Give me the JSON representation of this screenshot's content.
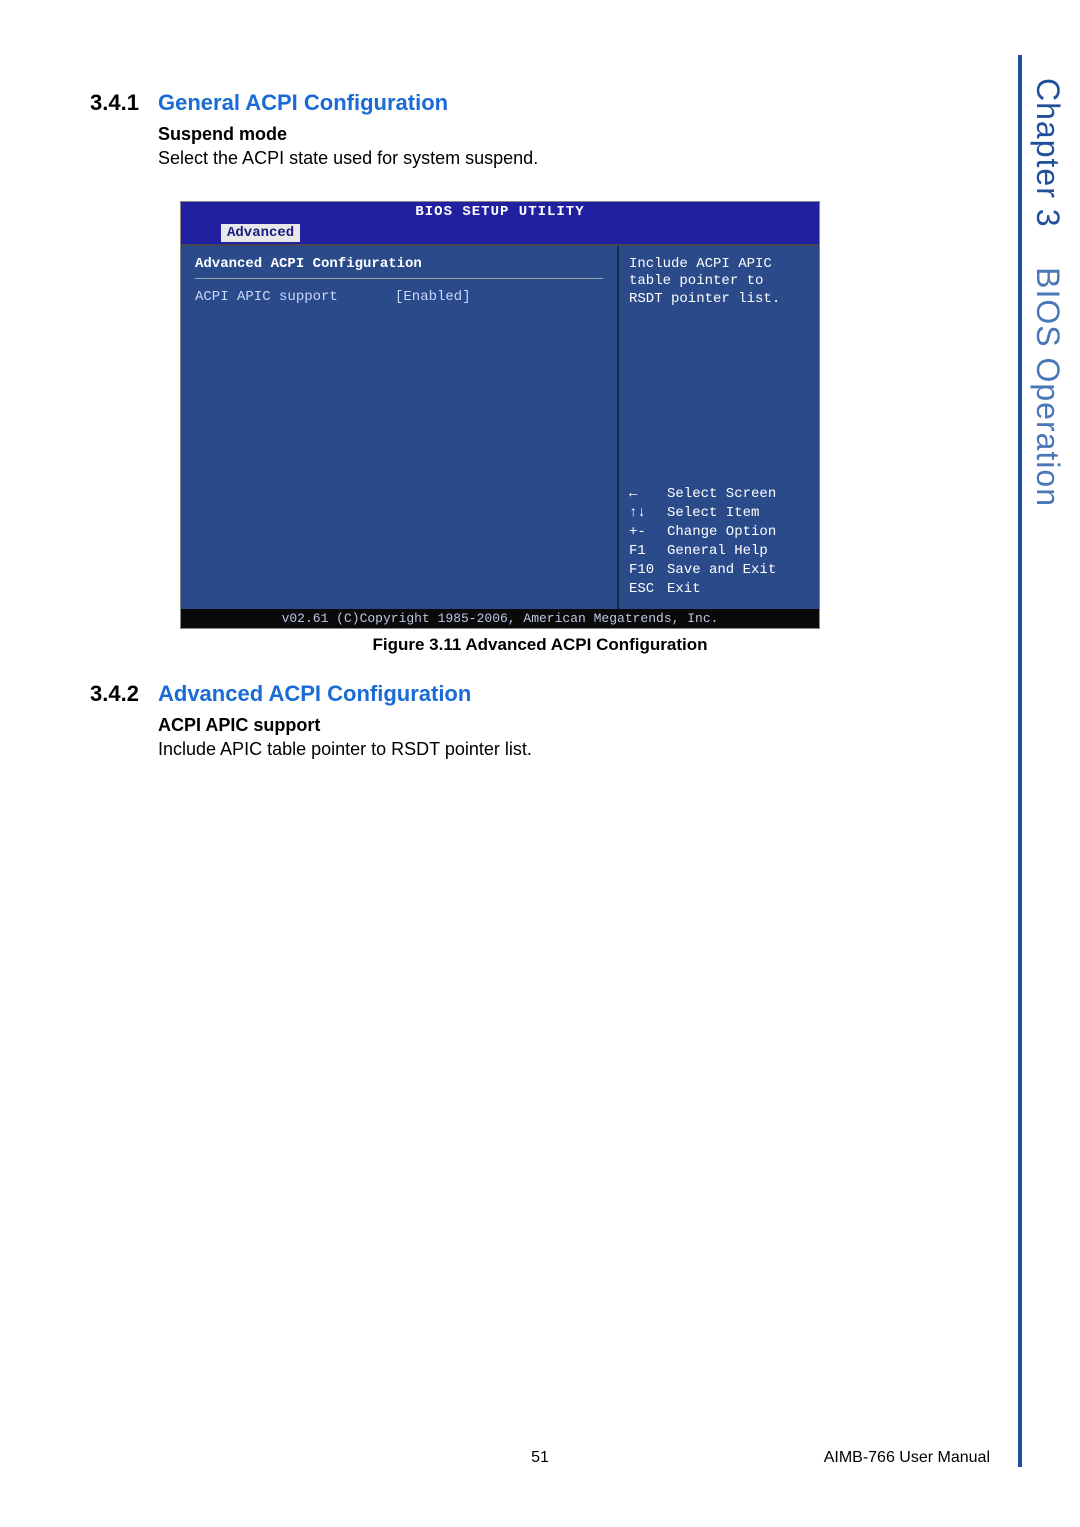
{
  "side": {
    "chapter": "Chapter 3",
    "title": "BIOS Operation"
  },
  "sec1": {
    "num": "3.4.1",
    "title": "General ACPI Configuration",
    "bold": "Suspend mode",
    "para": "Select the ACPI state used for system suspend."
  },
  "bios": {
    "title": "BIOS SETUP UTILITY",
    "tab": "Advanced",
    "header": "Advanced ACPI Configuration",
    "row_label": "ACPI APIC support",
    "row_value": "[Enabled]",
    "help_line1": "Include ACPI APIC",
    "help_line2": "table pointer to",
    "help_line3": "RSDT pointer list.",
    "keys": {
      "k1": "←",
      "l1": "Select Screen",
      "k2": "↑↓",
      "l2": "Select Item",
      "k3": "+-",
      "l3": "Change Option",
      "k4": "F1",
      "l4": "General Help",
      "k5": "F10",
      "l5": "Save and Exit",
      "k6": "ESC",
      "l6": "Exit"
    },
    "footer": "v02.61 (C)Copyright 1985-2006, American Megatrends, Inc."
  },
  "caption": "Figure 3.11 Advanced ACPI Configuration",
  "sec2": {
    "num": "3.4.2",
    "title": "Advanced ACPI Configuration",
    "bold": "ACPI APIC support",
    "para": "Include APIC table pointer to RSDT pointer list."
  },
  "footer": {
    "page": "51",
    "doc": "AIMB-766 User Manual"
  }
}
